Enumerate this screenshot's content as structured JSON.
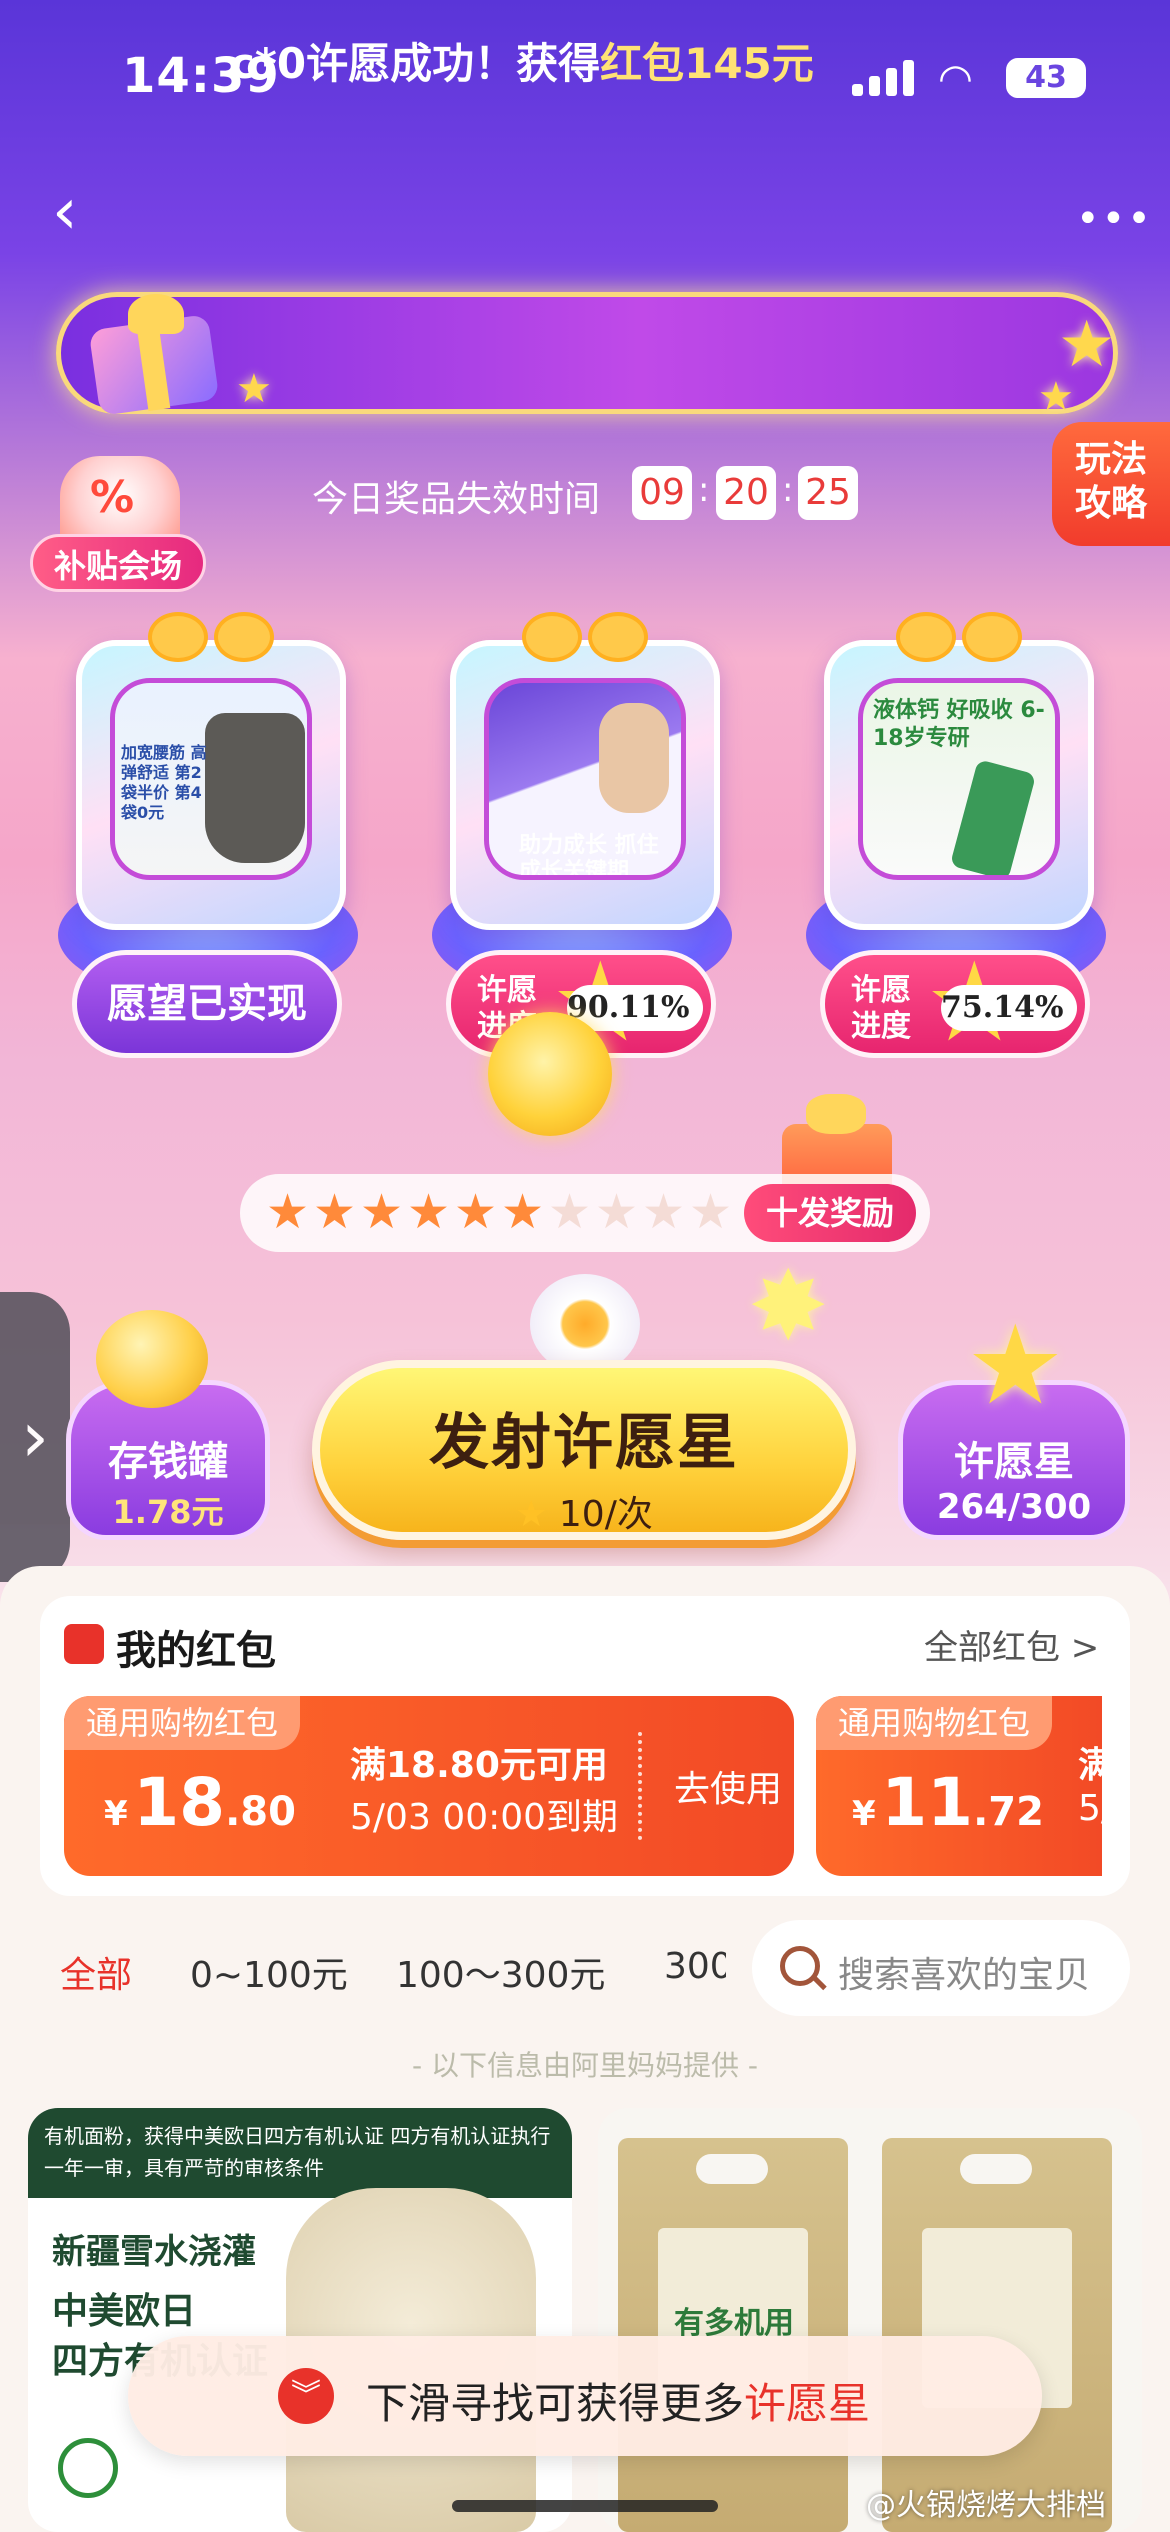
{
  "status_bar": {
    "time": "14:39",
    "battery": "43"
  },
  "banner": {
    "prefix": "c*0许愿成功！获得",
    "highlight": "红包145元"
  },
  "strategy_button": {
    "line1": "玩法",
    "line2": "攻略"
  },
  "subsidy": {
    "icon_text": "%",
    "label": "补贴会场"
  },
  "countdown": {
    "label": "今日奖品失效时间",
    "hours": "09",
    "minutes": "20",
    "seconds": "25"
  },
  "prizes": [
    {
      "status_label": "愿望已实现",
      "progress": null,
      "image_text": "加宽腰筋 高弹舒适 第2袋半价 第4袋0元"
    },
    {
      "status_label": "许愿进度",
      "progress": "90.11%",
      "image_text": "助力成长 抓住成长关键期"
    },
    {
      "status_label": "许愿进度",
      "progress": "75.14%",
      "image_text": "液体钙 好吸收 6-18岁专研"
    }
  ],
  "progress_stars": {
    "filled": 6,
    "total": 10,
    "reward_label": "十发奖励"
  },
  "piggy_bank": {
    "label": "存钱罐",
    "value": "1.78元"
  },
  "launch": {
    "label": "发射许愿星",
    "cost": "10/次"
  },
  "wish_stars": {
    "label": "许愿星",
    "value": "264/300"
  },
  "red_packets": {
    "title": "我的红包",
    "all_link": "全部红包 >",
    "coupons": [
      {
        "tag": "通用购物红包",
        "yen": "¥",
        "amount_int": "18",
        "amount_dec": ".80",
        "condition": "满18.80元可用",
        "expiry": "5/03 00:00到期",
        "action": "去使用"
      },
      {
        "tag": "通用购物红包",
        "yen": "¥",
        "amount_int": "11",
        "amount_dec": ".72",
        "condition": "满",
        "expiry": "5/",
        "action": ""
      }
    ]
  },
  "filter_tabs": [
    "全部",
    "0~100元",
    "100～300元",
    "300"
  ],
  "search": {
    "placeholder": "搜索喜欢的宝贝"
  },
  "provider_note": "- 以下信息由阿里妈妈提供 -",
  "products": [
    {
      "header": "有机面粉，获得中美欧日四方有机认证 四方有机认证执行一年一审，具有严苛的审核条件",
      "line1": "新疆雪水浇灌",
      "line2": "中美欧日",
      "line3": "四方有机认证"
    },
    {
      "label": "有多机用"
    }
  ],
  "toast": {
    "prefix": "下滑寻找可获得更多",
    "highlight": "许愿星"
  },
  "watermark": "@火锅烧烤大排档",
  "colors": {
    "accent_red": "#e8322a",
    "brand_purple": "#7b35d8",
    "gold": "#ffd845"
  }
}
